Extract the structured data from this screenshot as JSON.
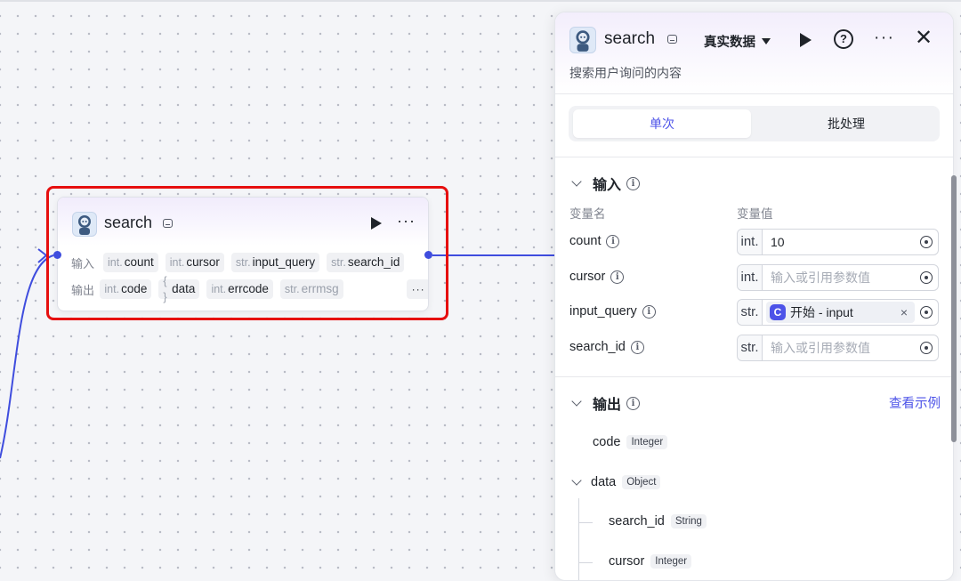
{
  "node": {
    "title": "search",
    "db_icon": "database-icon",
    "run_icon": "play-icon",
    "more_label": "···",
    "input_label": "输入",
    "output_label": "输出",
    "inputs": [
      {
        "type": "int.",
        "name": "count"
      },
      {
        "type": "int.",
        "name": "cursor"
      },
      {
        "type": "str.",
        "name": "input_query"
      },
      {
        "type": "str.",
        "name": "search_id"
      }
    ],
    "outputs": [
      {
        "type": "int.",
        "name": "code"
      },
      {
        "type": "{ }",
        "name": "data"
      },
      {
        "type": "int.",
        "name": "errcode"
      },
      {
        "type": "str.",
        "name": "errmsg"
      }
    ],
    "outputs_more": "···",
    "highlight_color": "#e60f0f",
    "edge_color": "#3f4dde"
  },
  "panel": {
    "title": "search",
    "mode": "真实数据",
    "help": "?",
    "more": "···",
    "close": "✕",
    "description": "搜索用户询问的内容",
    "tabs": {
      "single": "单次",
      "batch": "批处理"
    },
    "input_section": {
      "title": "输入",
      "col_name": "变量名",
      "col_value": "变量值",
      "vars": [
        {
          "name": "count",
          "type": "int.",
          "value": "10",
          "placeholder": ""
        },
        {
          "name": "cursor",
          "type": "int.",
          "value": "",
          "placeholder": "输入或引用参数值"
        },
        {
          "name": "input_query",
          "type": "str.",
          "ref_icon": "C",
          "ref_source": "开始",
          "ref_sep": " - ",
          "ref_var": "input",
          "clear": "×"
        },
        {
          "name": "search_id",
          "type": "str.",
          "value": "",
          "placeholder": "输入或引用参数值"
        }
      ]
    },
    "output_section": {
      "title": "输出",
      "see_example": "查看示例",
      "fields": [
        {
          "name": "code",
          "type": "Integer"
        },
        {
          "name": "data",
          "type": "Object"
        },
        {
          "name": "search_id",
          "type": "String"
        },
        {
          "name": "cursor",
          "type": "Integer"
        }
      ]
    },
    "accent_color": "#4d53e8"
  }
}
